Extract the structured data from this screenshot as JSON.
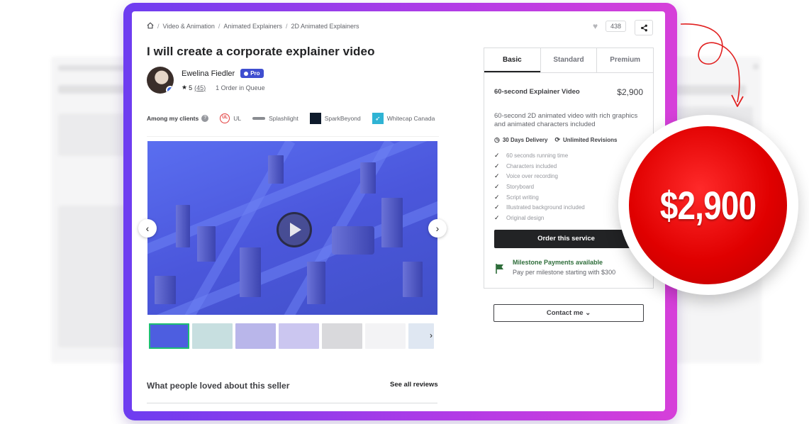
{
  "breadcrumb": [
    "Video & Animation",
    "Animated Explainers",
    "2D Animated Explainers"
  ],
  "favorites_count": "438",
  "gig_title": "I will create a corporate explainer video",
  "seller": {
    "name": "Ewelina Fiedler",
    "badge": "Pro",
    "rating": "5",
    "reviews": "(45)",
    "queue": "1 Order in Queue"
  },
  "clients": {
    "label": "Among my clients",
    "items": [
      "UL",
      "Splashlight",
      "SparkBeyond",
      "Whitecap Canada"
    ]
  },
  "package": {
    "tabs": [
      "Basic",
      "Standard",
      "Premium"
    ],
    "title": "60-second Explainer Video",
    "price": "$2,900",
    "description": "60-second 2D animated video with rich graphics and animated characters included",
    "delivery": "30 Days Delivery",
    "revisions": "Unlimited Revisions",
    "features": [
      "60 seconds running time",
      "Characters included",
      "Voice over recording",
      "Storyboard",
      "Script writing",
      "Illustrated background included",
      "Original design"
    ],
    "order_button": "Order this service",
    "milestone_title": "Milestone Payments available",
    "milestone_text": "Pay per milestone starting with $300"
  },
  "contact_button": "Contact me",
  "reviews_section": {
    "title": "What people loved about this seller",
    "link": "See all reviews"
  },
  "price_badge": "$2,900",
  "colors": {
    "frame_start": "#6d3df0",
    "frame_end": "#d63fd9",
    "badge_red": "#e00000",
    "pro_badge": "#3f4ed0",
    "milestone_green": "#2e6d3a",
    "video_blue": "#4b57dc"
  },
  "icons": [
    "home-icon",
    "heart-icon",
    "share-icon",
    "star-icon",
    "clock-icon",
    "refresh-icon",
    "check-icon",
    "flag-icon",
    "chevron-down-icon",
    "play-icon",
    "arrow-left-icon",
    "arrow-right-icon"
  ]
}
